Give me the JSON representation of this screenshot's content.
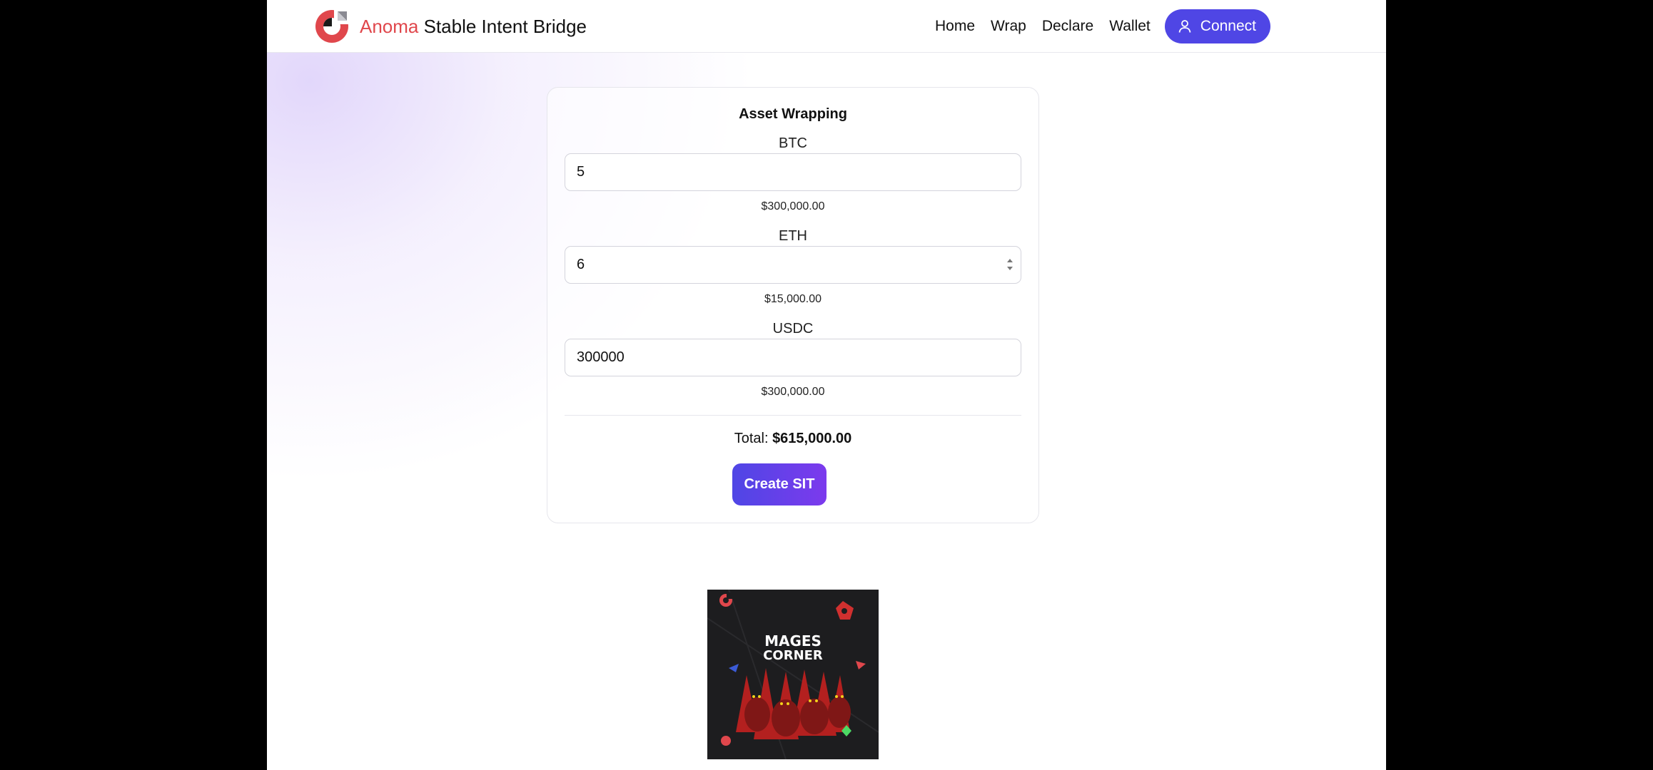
{
  "header": {
    "brand_accent": "Anoma",
    "brand_rest": " Stable Intent Bridge",
    "nav": [
      "Home",
      "Wrap",
      "Declare",
      "Wallet"
    ],
    "connect_label": "Connect"
  },
  "card": {
    "title": "Asset Wrapping",
    "fields": [
      {
        "label": "BTC",
        "value": "5",
        "usd": "$300,000.00"
      },
      {
        "label": "ETH",
        "value": "6",
        "usd": "$15,000.00"
      },
      {
        "label": "USDC",
        "value": "300000",
        "usd": "$300,000.00"
      }
    ],
    "total_label": "Total: ",
    "total_value": "$615,000.00",
    "create_label": "Create SIT"
  },
  "banner": {
    "line1": "MAGES",
    "line2": "CORNER"
  },
  "colors": {
    "accent": "#4f46e5",
    "brand_red": "#e0474c"
  },
  "icons": {
    "connect": "user-icon",
    "logo": "anoma-logo-icon"
  }
}
